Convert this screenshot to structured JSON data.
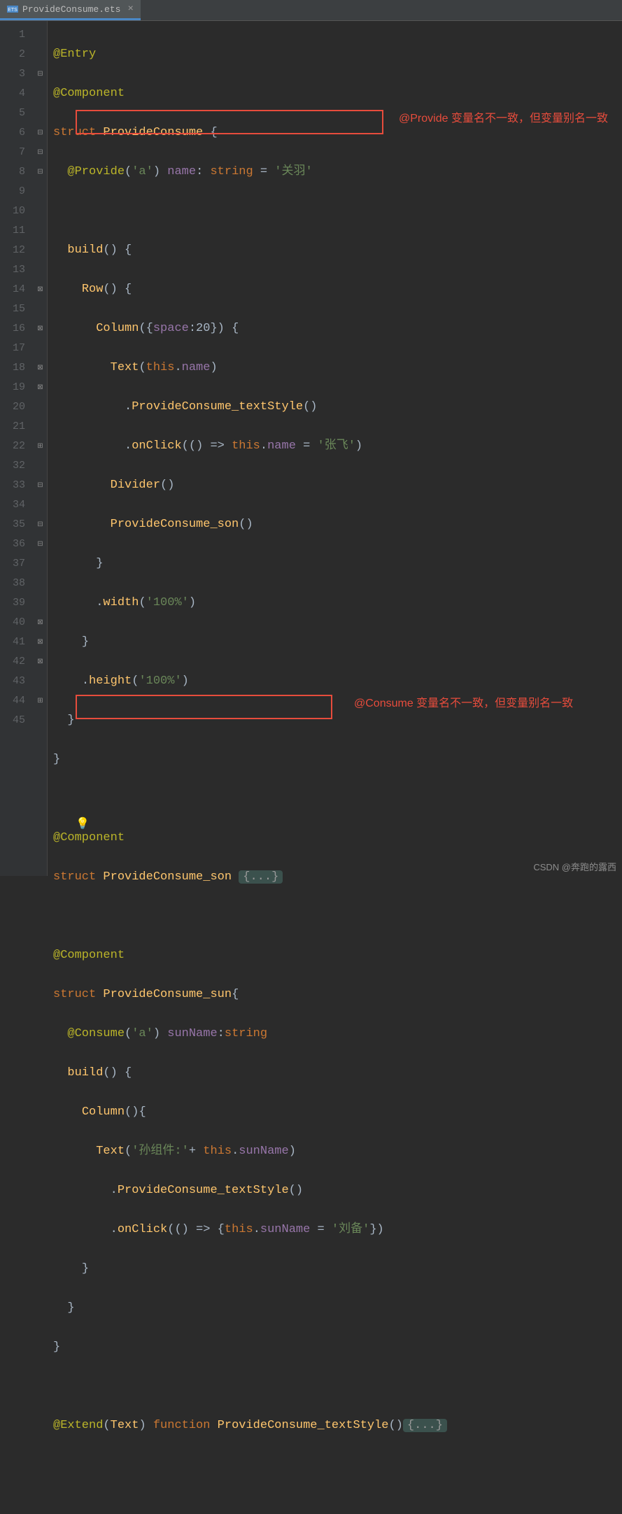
{
  "tab": {
    "filename": "ProvideConsume.ets",
    "icon_label": "ETS"
  },
  "gutter_lines": [
    "1",
    "2",
    "3",
    "4",
    "5",
    "6",
    "7",
    "8",
    "9",
    "10",
    "11",
    "12",
    "13",
    "14",
    "15",
    "16",
    "17",
    "18",
    "19",
    "20",
    "21",
    "22",
    "32",
    "33",
    "34",
    "35",
    "36",
    "37",
    "38",
    "39",
    "40",
    "41",
    "42",
    "43",
    "44",
    "45"
  ],
  "code": {
    "l1": {
      "dec": "@Entry"
    },
    "l2": {
      "dec": "@Component"
    },
    "l3": {
      "kw": "struct",
      "name": "ProvideConsume",
      "brace": " {"
    },
    "l4": {
      "dec": "@Provide",
      "arg": "'a'",
      "prop": "name",
      "colon": ": ",
      "type": "string",
      "eq": " = ",
      "str": "'关羽'"
    },
    "l6": {
      "fn": "build",
      "paren": "()",
      "brace": " {"
    },
    "l7": {
      "call": "Row",
      "paren": "()",
      "brace": " {"
    },
    "l8": {
      "call": "Column",
      "args_open": "({",
      "key": "space",
      "val": ":20",
      "args_close": "})",
      "brace": " {"
    },
    "l9": {
      "call": "Text",
      "open": "(",
      "this": "this",
      "dot": ".",
      "prop": "name",
      "close": ")"
    },
    "l10": {
      "dot": ".",
      "call": "ProvideConsume_textStyle",
      "paren": "()"
    },
    "l11": {
      "dot": ".",
      "call": "onClick",
      "open": "((",
      "close1": ")",
      "arrow": " => ",
      "this": "this",
      "dot2": ".",
      "prop": "name",
      "eq": " = ",
      "str": "'张飞'",
      "close2": ")"
    },
    "l12": {
      "call": "Divider",
      "paren": "()"
    },
    "l13": {
      "call": "ProvideConsume_son",
      "paren": "()"
    },
    "l14": {
      "brace": "}"
    },
    "l15": {
      "dot": ".",
      "call": "width",
      "open": "(",
      "str": "'100%'",
      "close": ")"
    },
    "l16": {
      "brace": "}"
    },
    "l17": {
      "dot": ".",
      "call": "height",
      "open": "(",
      "str": "'100%'",
      "close": ")"
    },
    "l18": {
      "brace": "}"
    },
    "l19": {
      "brace": "}"
    },
    "l21": {
      "dec": "@Component"
    },
    "l22": {
      "kw": "struct",
      "name": "ProvideConsume_son",
      "folded": "{...}"
    },
    "l33": {
      "dec": "@Component"
    },
    "l34": {
      "kw": "struct",
      "name": "ProvideConsume_sun",
      "brace": "{"
    },
    "l35": {
      "dec": "@Consume",
      "arg": "'a'",
      "prop": "sunName",
      "colon": ":",
      "type": "string"
    },
    "l36": {
      "fn": "build",
      "paren": "()",
      "brace": " {"
    },
    "l37": {
      "call": "Column",
      "paren": "()",
      "brace": "{"
    },
    "l38": {
      "call": "Text",
      "open": "(",
      "str": "'孙组件:'",
      "plus": "+ ",
      "this": "this",
      "dot": ".",
      "prop": "sunName",
      "close": ")"
    },
    "l39": {
      "dot": ".",
      "call": "ProvideConsume_textStyle",
      "paren": "()"
    },
    "l40": {
      "dot": ".",
      "call": "onClick",
      "open": "((",
      "close1": ")",
      "arrow": " => {",
      "this": "this",
      "dot2": ".",
      "prop": "sunName",
      "eq": " = ",
      "str": "'刘备'",
      "close2": "})"
    },
    "l41": {
      "brace": "}"
    },
    "l42": {
      "brace": "}"
    },
    "l43": {
      "brace": "}"
    },
    "l45": {
      "dec": "@Extend",
      "open": "(",
      "arg_call": "Text",
      "close": ") ",
      "kw": "function",
      "name": "ProvideConsume_textStyle",
      "paren": "()",
      "folded": "{...}"
    }
  },
  "annotations": {
    "a1": "@Provide 变量名不一致，但变量别名一致",
    "a2": "@Consume 变量名不一致，但变量别名一致"
  },
  "watermark": "CSDN @奔跑的露西"
}
